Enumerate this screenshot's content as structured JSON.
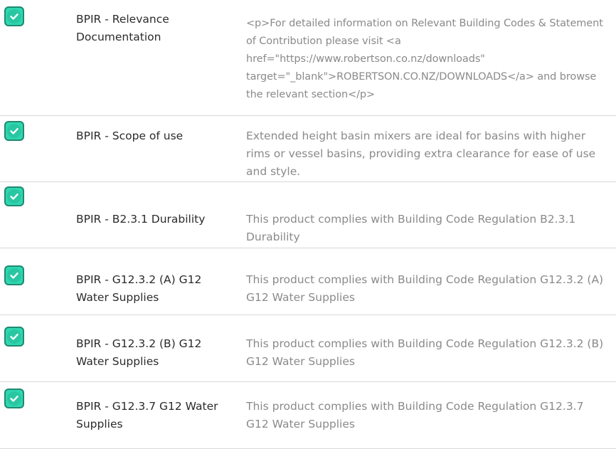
{
  "rows": [
    {
      "label": "BPIR - Relevance Documentation",
      "description": "<p>For detailed information on Relevant Building Codes & Statement of Contribution please visit <a href=\"https://www.robertson.co.nz/downloads\" target=\"_blank\">ROBERTSON.CO.NZ/DOWNLOADS</a> and browse the relevant section</p>",
      "status_icon": "check-icon"
    },
    {
      "label": "BPIR - Scope of use",
      "description": "Extended height basin mixers are ideal for basins with higher rims or vessel basins, providing extra clearance for ease of use and style.",
      "status_icon": "check-icon"
    },
    {
      "label": "BPIR - B2.3.1 Durability",
      "description": "This product complies with Building Code Regulation B2.3.1 Durability",
      "status_icon": "check-icon"
    },
    {
      "label": "BPIR - G12.3.2 (A) G12 Water Supplies",
      "description": "This product complies with Building Code Regulation G12.3.2 (A) G12 Water Supplies",
      "status_icon": "check-icon"
    },
    {
      "label": "BPIR - G12.3.2 (B) G12 Water Supplies",
      "description": "This product complies with Building Code Regulation G12.3.2 (B) G12 Water Supplies",
      "status_icon": "check-icon"
    },
    {
      "label": "BPIR - G12.3.7 G12 Water Supplies",
      "description": "This product complies with Building Code Regulation G12.3.7 G12 Water Supplies",
      "status_icon": "check-icon"
    }
  ],
  "colors": {
    "check_fill": "#28c7a1",
    "divider": "#d9d9d9",
    "label_text": "#2b2b2b",
    "description_text": "#8a8a8a"
  }
}
